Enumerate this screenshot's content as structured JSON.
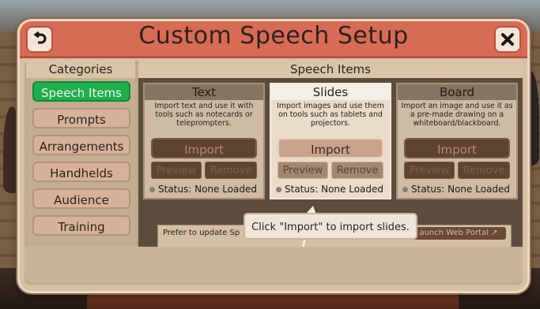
{
  "window": {
    "title": "Custom Speech Setup"
  },
  "categories": {
    "header": "Categories",
    "items": [
      {
        "label": "Speech Items",
        "active": true
      },
      {
        "label": "Prompts"
      },
      {
        "label": "Arrangements"
      },
      {
        "label": "Handhelds"
      },
      {
        "label": "Audience"
      },
      {
        "label": "Training"
      }
    ]
  },
  "speech_items": {
    "header": "Speech Items",
    "cards": [
      {
        "title": "Text",
        "description": "Import text and use it with tools such as notecards or teleprompters.",
        "import_label": "Import",
        "preview_label": "Preview",
        "remove_label": "Remove",
        "status": "Status: None Loaded"
      },
      {
        "title": "Slides",
        "description": "Import images and use them on tools such as tablets and projectors.",
        "import_label": "Import",
        "preview_label": "Preview",
        "remove_label": "Remove",
        "status": "Status: None Loaded"
      },
      {
        "title": "Board",
        "description": "Import an image and use it as a pre-made drawing on a whiteboard/blackboard.",
        "import_label": "Import",
        "preview_label": "Preview",
        "remove_label": "Remove",
        "status": "Status: None Loaded"
      }
    ],
    "update_text": "Prefer to update Sp",
    "portal_label": "aunch Web Portal ↗"
  },
  "tooltip": {
    "text": "Click \"Import\" to import slides."
  },
  "icons": {
    "back": "back-arrow-icon",
    "close": "close-icon"
  },
  "colors": {
    "title_bar": "#d86b54",
    "active_category": "#1fae4e"
  }
}
